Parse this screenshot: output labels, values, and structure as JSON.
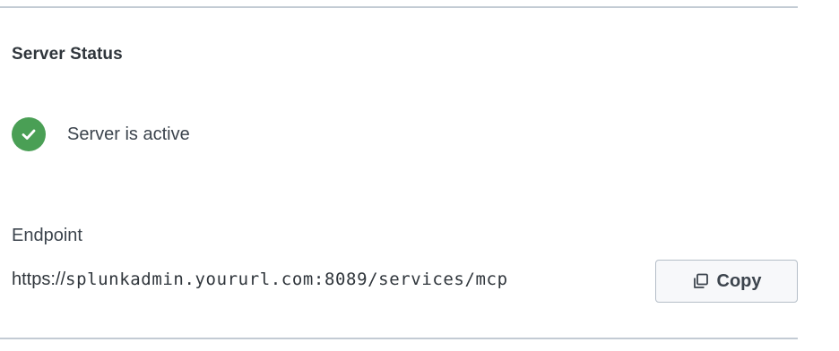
{
  "server_status": {
    "title": "Server Status",
    "status_text": "Server is active",
    "status_icon": "check-circle-icon",
    "status_color": "#4a9f55"
  },
  "endpoint": {
    "label": "Endpoint",
    "url_scheme": "https://",
    "url_rest": "splunkadmin.yoururl.com:8089/services/mcp",
    "copy_label": "Copy",
    "copy_icon": "copy-icon"
  },
  "colors": {
    "divider": "#c3cbd4",
    "text": "#3c444d",
    "success": "#4a9f55"
  }
}
